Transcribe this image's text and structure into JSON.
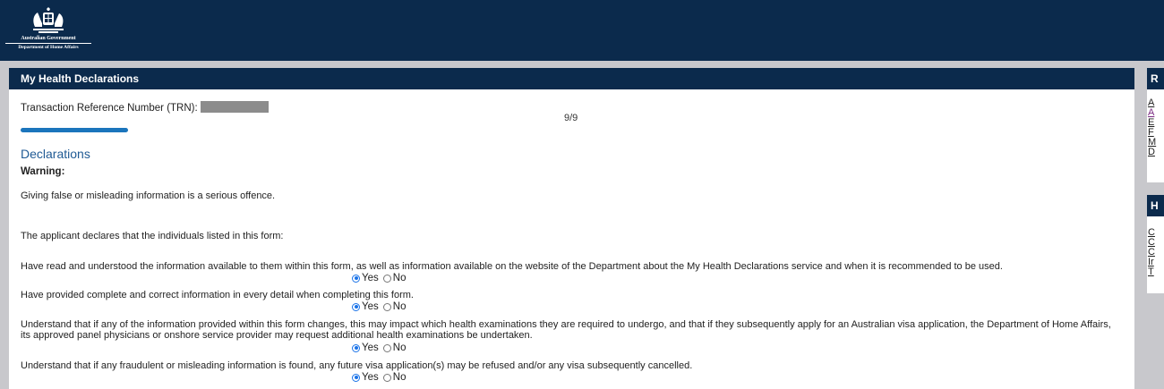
{
  "header": {
    "gov_name": "Australian Government",
    "dept_name": "Department of Home Affairs",
    "logo_icon": "coat-of-arms-icon"
  },
  "panel": {
    "title": "My Health Declarations"
  },
  "trn": {
    "label": "Transaction Reference Number (TRN):"
  },
  "progress": {
    "text": "9/9",
    "fraction": 1.0
  },
  "section": {
    "title": "Declarations",
    "warning_label": "Warning:",
    "warning_text": "Giving false or misleading information is a serious offence.",
    "intro": "The applicant declares that the individuals listed in this form:"
  },
  "questions": [
    {
      "text": "Have read and understood the information available to them within this form, as well as information available on the website of the Department about the My Health Declarations service and when it is recommended to be used.",
      "yes": "Yes",
      "no": "No",
      "answer": "yes"
    },
    {
      "text": "Have provided complete and correct information in every detail when completing this form.",
      "yes": "Yes",
      "no": "No",
      "answer": "yes"
    },
    {
      "text": "Understand that if any of the information provided within this form changes, this may impact which health examinations they are required to undergo, and that if they subsequently apply for an Australian visa application, the Department of Home Affairs, its approved panel physicians or onshore service provider may request additional health examinations be undertaken.",
      "yes": "Yes",
      "no": "No",
      "answer": "yes"
    },
    {
      "text": "Understand that if any fraudulent or misleading information is found, any future visa application(s) may be refused and/or any visa subsequently cancelled.",
      "yes": "Yes",
      "no": "No",
      "answer": "yes"
    }
  ],
  "right_panels": [
    {
      "title": "R",
      "links": [
        "A",
        "A",
        "E",
        "F",
        "M",
        "D"
      ]
    },
    {
      "title": "H",
      "links": [
        "C",
        "C",
        "C",
        "Ir",
        "T"
      ]
    }
  ],
  "colors": {
    "navy": "#0b2a4c",
    "accent": "#1b75bc",
    "heading": "#1f5a94"
  }
}
